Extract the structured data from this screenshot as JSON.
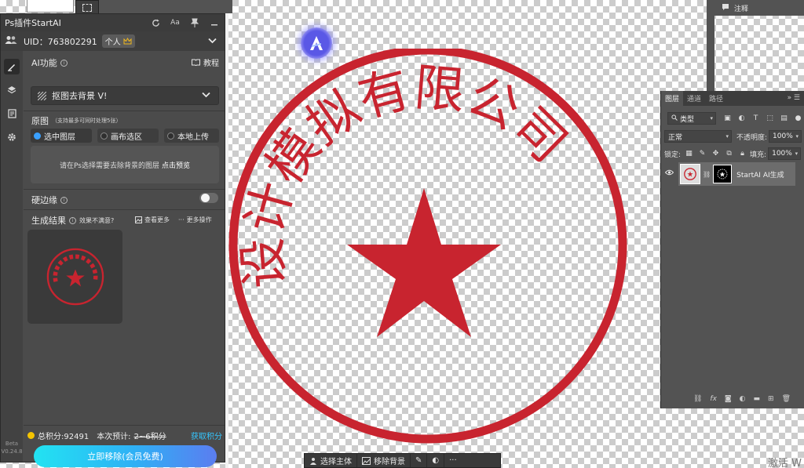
{
  "panel": {
    "title": "Ps插件StartAI",
    "uid": "UID：763802291",
    "plan_badge": "个人",
    "ai_function_label": "AI功能",
    "tutorial_label": "教程",
    "tool_selected": "抠图去背景 V!",
    "source_label": "原图",
    "source_hint": "（支持最多可同时处理5张）",
    "source_options": [
      "选中图层",
      "画布选区",
      "本地上传"
    ],
    "dropzone_text": "请在Ps选择需要去除背景的图层",
    "dropzone_link": "点击预览",
    "hard_edge_label": "硬边缘",
    "result_label": "生成结果",
    "unsatisfied_label": "效果不满意?",
    "view_more_label": "查看更多",
    "more_actions_label": "更多操作",
    "points_label": "总积分:92491",
    "estimate_label": "本次预计:",
    "estimate_value": "2~6积分",
    "get_points_label": "获取积分",
    "cta_label": "立即移除(会员免费)",
    "version_line1": "Beta",
    "version_line2": "V0.24.8"
  },
  "layers": {
    "tabs": [
      "图层",
      "通道",
      "路径"
    ],
    "filter_kind": "类型",
    "blend_mode": "正常",
    "opacity_label": "不透明度:",
    "opacity_value": "100%",
    "lock_label": "锁定:",
    "fill_label": "填充:",
    "fill_value": "100%",
    "layer_name": "StartAI AI生成"
  },
  "notes": {
    "label": "注释"
  },
  "bottom_toolbar": {
    "select_subject": "选择主体",
    "remove_background": "移除背景"
  },
  "watermark": "激活 W",
  "stamp": {
    "text": "设计模拟有限公司",
    "color": "#c8242f"
  },
  "colors": {
    "accent": "#34c6ff",
    "cta_start": "#22e3f2",
    "cta_end": "#5b7df0"
  }
}
